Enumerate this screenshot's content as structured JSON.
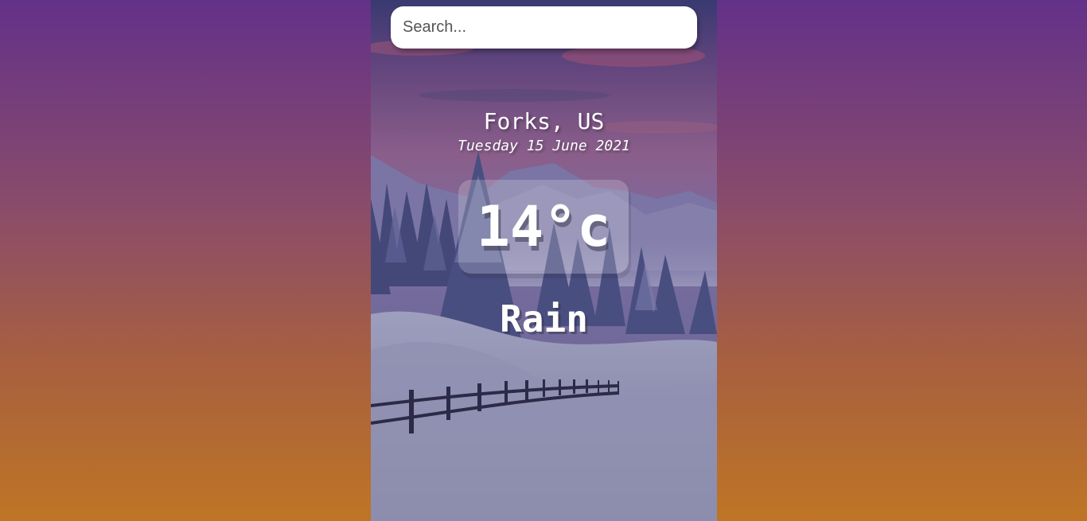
{
  "search": {
    "placeholder": "Search...",
    "value": ""
  },
  "location": {
    "city_country": "Forks, US",
    "date": "Tuesday 15 June 2021"
  },
  "weather": {
    "temperature": "14°c",
    "condition": "Rain"
  },
  "colors": {
    "gradient_top": "#633189",
    "gradient_bottom": "#bf7524"
  }
}
